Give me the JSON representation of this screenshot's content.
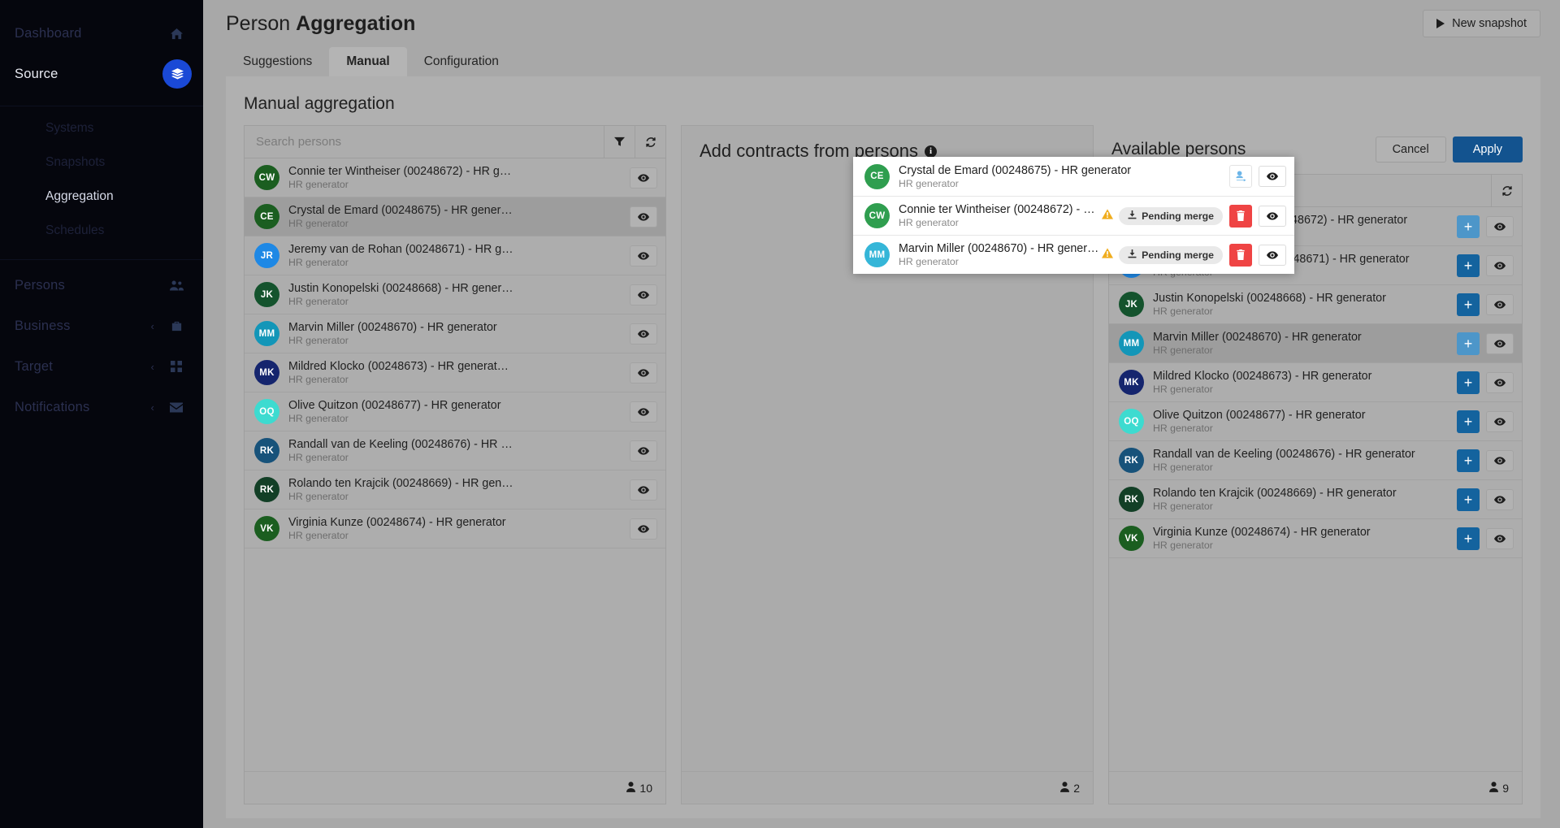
{
  "sidebar": {
    "items": [
      {
        "label": "Dashboard",
        "icon": "home-icon"
      },
      {
        "label": "Source",
        "icon": "layers-icon",
        "chevron": "∨",
        "active": true
      },
      {
        "label": "Persons",
        "icon": "people-icon"
      },
      {
        "label": "Business",
        "icon": "briefcase-icon",
        "chevron": "‹"
      },
      {
        "label": "Target",
        "icon": "grid-icon",
        "chevron": "‹"
      },
      {
        "label": "Notifications",
        "icon": "mail-icon",
        "chevron": "‹"
      }
    ],
    "sub_items": [
      {
        "label": "Systems"
      },
      {
        "label": "Snapshots"
      },
      {
        "label": "Aggregation",
        "selected": true
      },
      {
        "label": "Schedules"
      }
    ]
  },
  "header": {
    "title_light": "Person ",
    "title_bold": "Aggregation",
    "new_snapshot_label": "New snapshot",
    "new_snapshot_icon": "play-icon"
  },
  "tabs": [
    {
      "label": "Suggestions",
      "active": false
    },
    {
      "label": "Manual",
      "active": true
    },
    {
      "label": "Configuration",
      "active": false
    }
  ],
  "section_title": "Manual aggregation",
  "left_panel": {
    "search_placeholder": "Search persons",
    "search_value": "",
    "filter_icon": "filter-icon",
    "refresh_icon": "refresh-icon",
    "eye_icon": "eye-icon",
    "count": "10",
    "count_icon": "person-icon",
    "rows": [
      {
        "initials": "CW",
        "color": "#1b5e20",
        "name": "Connie ter Wintheiser (00248672) - HR g…",
        "sub": "HR generator",
        "selected": false
      },
      {
        "initials": "CE",
        "color": "#1b5e20",
        "name": "Crystal de Emard (00248675) - HR gener…",
        "sub": "HR generator",
        "selected": true
      },
      {
        "initials": "JR",
        "color": "#1e88e5",
        "name": "Jeremy van de Rohan (00248671) - HR g…",
        "sub": "HR generator",
        "selected": false
      },
      {
        "initials": "JK",
        "color": "#14532d",
        "name": "Justin Konopelski (00248668) - HR gener…",
        "sub": "HR generator",
        "selected": false
      },
      {
        "initials": "MM",
        "color": "#1396b8",
        "name": "Marvin Miller (00248670) - HR generator",
        "sub": "HR generator",
        "selected": false
      },
      {
        "initials": "MK",
        "color": "#15256e",
        "name": "Mildred Klocko (00248673) - HR generat…",
        "sub": "HR generator",
        "selected": false
      },
      {
        "initials": "OQ",
        "color": "#3ddbd0",
        "name": "Olive Quitzon (00248677) - HR generator",
        "sub": "HR generator",
        "selected": false
      },
      {
        "initials": "RK",
        "color": "#17527a",
        "name": "Randall van de Keeling (00248676) - HR …",
        "sub": "HR generator",
        "selected": false
      },
      {
        "initials": "RK",
        "color": "#123f26",
        "name": "Rolando ten Krajcik (00248669) - HR gen…",
        "sub": "HR generator",
        "selected": false
      },
      {
        "initials": "VK",
        "color": "#1b5e20",
        "name": "Virginia Kunze (00248674) - HR generator",
        "sub": "HR generator",
        "selected": false
      }
    ]
  },
  "mid_panel": {
    "title": "Add contracts from persons",
    "info_icon": "info-icon",
    "info_glyph": "i",
    "count": "2",
    "count_icon": "person-icon",
    "rows": [
      {
        "initials": "CE",
        "color": "#2f9e4f",
        "name": "Crystal de Emard (00248675) - HR generator",
        "sub": "HR generator",
        "badge": null,
        "warn": false,
        "actions": [
          "move-person-icon",
          "eye-icon"
        ]
      },
      {
        "initials": "CW",
        "color": "#2f9e4f",
        "name": "Connie ter Wintheiser (00248672) - H…",
        "sub": "HR generator",
        "badge": "Pending merge",
        "badge_icon": "merge-download-icon",
        "warn": true,
        "actions": [
          "delete-icon",
          "eye-icon"
        ]
      },
      {
        "initials": "MM",
        "color": "#35b6d8",
        "name": "Marvin Miller (00248670) - HR genera…",
        "sub": "HR generator",
        "badge": "Pending merge",
        "badge_icon": "merge-download-icon",
        "warn": true,
        "actions": [
          "delete-icon",
          "eye-icon"
        ]
      }
    ]
  },
  "right_panel": {
    "title": "Available persons",
    "cancel_label": "Cancel",
    "apply_label": "Apply",
    "search_placeholder": "Search persons",
    "search_value": "",
    "refresh_icon": "refresh-icon",
    "add_icon": "plus-icon",
    "eye_icon": "eye-icon",
    "count": "9",
    "count_icon": "person-icon",
    "rows": [
      {
        "initials": "CW",
        "color": "#1b5e20",
        "name": "Connie ter Wintheiser (00248672) - HR generator",
        "sub": "HR generator",
        "selected": false,
        "add_dim": true
      },
      {
        "initials": "JR",
        "color": "#1e88e5",
        "name": "Jeremy van de Rohan (00248671) - HR generator",
        "sub": "HR generator",
        "selected": false,
        "add_dim": false
      },
      {
        "initials": "JK",
        "color": "#14532d",
        "name": "Justin Konopelski (00248668) - HR generator",
        "sub": "HR generator",
        "selected": false,
        "add_dim": false
      },
      {
        "initials": "MM",
        "color": "#1396b8",
        "name": "Marvin Miller (00248670) - HR generator",
        "sub": "HR generator",
        "selected": true,
        "add_dim": true
      },
      {
        "initials": "MK",
        "color": "#15256e",
        "name": "Mildred Klocko (00248673) - HR generator",
        "sub": "HR generator",
        "selected": false,
        "add_dim": false
      },
      {
        "initials": "OQ",
        "color": "#3ddbd0",
        "name": "Olive Quitzon (00248677) - HR generator",
        "sub": "HR generator",
        "selected": false,
        "add_dim": false
      },
      {
        "initials": "RK",
        "color": "#17527a",
        "name": "Randall van de Keeling (00248676) - HR generator",
        "sub": "HR generator",
        "selected": false,
        "add_dim": false
      },
      {
        "initials": "RK",
        "color": "#123f26",
        "name": "Rolando ten Krajcik (00248669) - HR generator",
        "sub": "HR generator",
        "selected": false,
        "add_dim": false
      },
      {
        "initials": "VK",
        "color": "#1b5e20",
        "name": "Virginia Kunze (00248674) - HR generator",
        "sub": "HR generator",
        "selected": false,
        "add_dim": false
      }
    ]
  },
  "colors": {
    "accent_blue": "#13538f",
    "sidebar_pill": "#1a49d6",
    "danger": "#ef4444",
    "warning": "#f0ad1e",
    "backdrop": "#a8a8a8"
  }
}
